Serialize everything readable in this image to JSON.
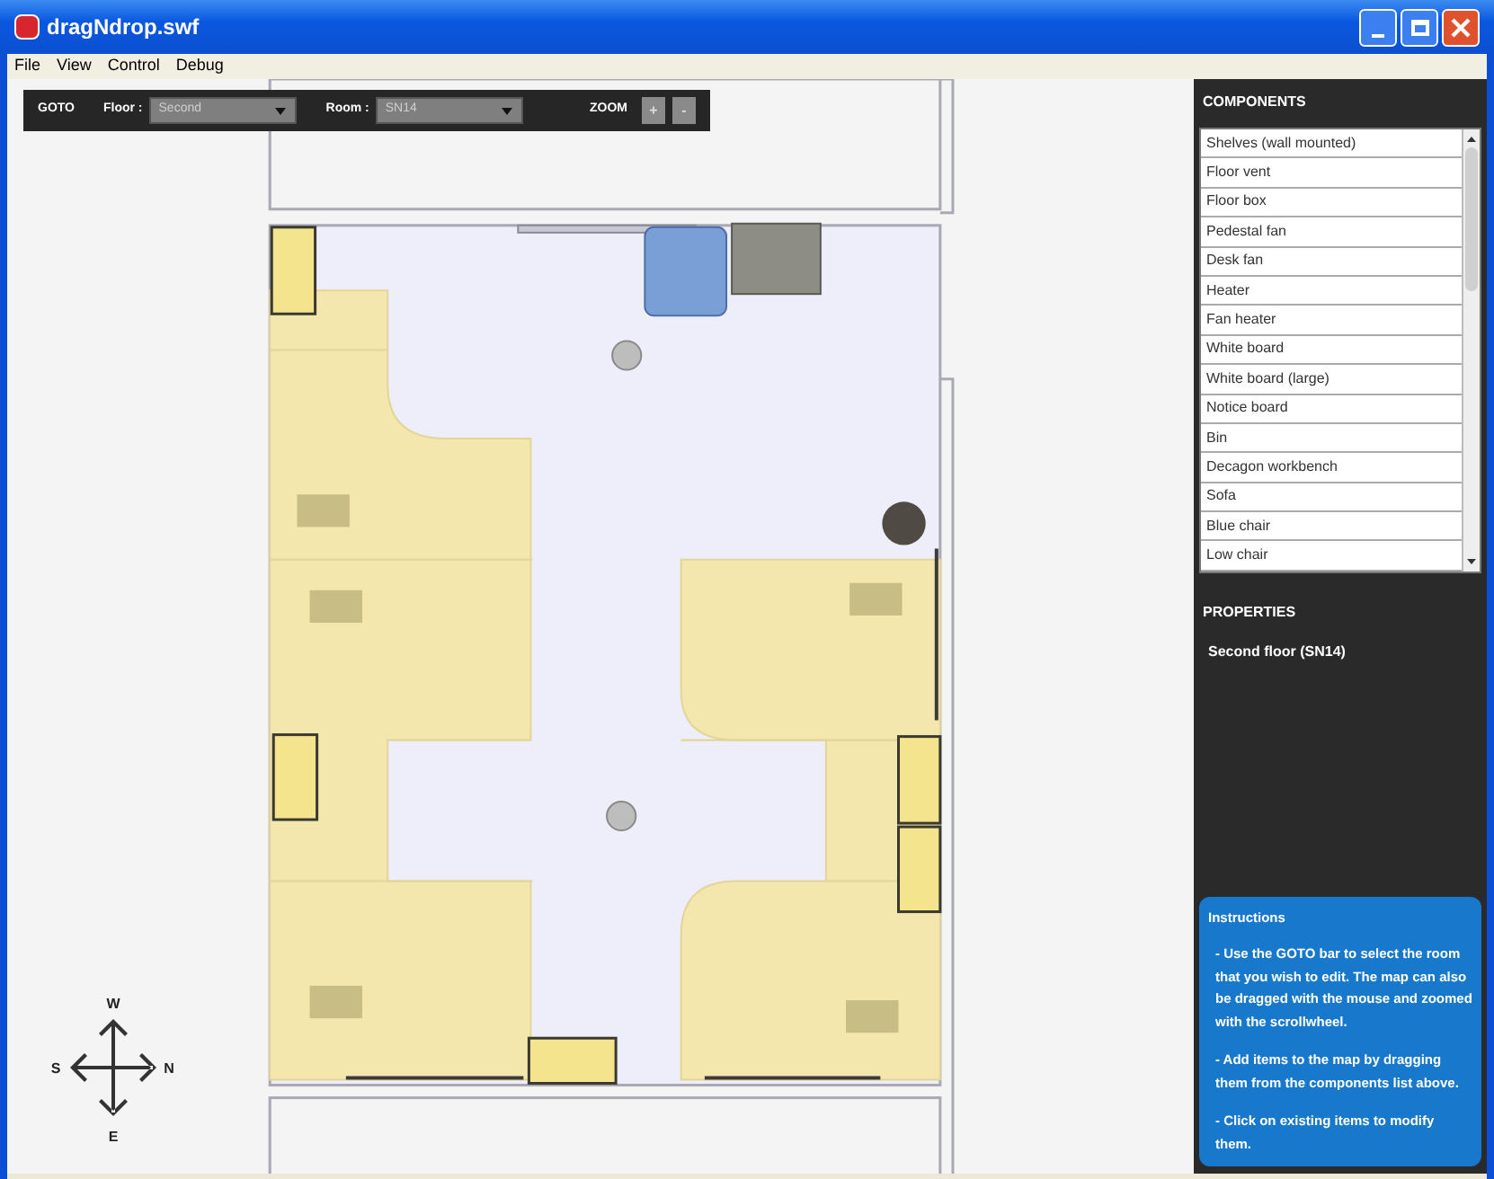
{
  "window": {
    "title": "dragNdrop.swf"
  },
  "menu": [
    "File",
    "View",
    "Control",
    "Debug"
  ],
  "toolbar": {
    "goto": "GOTO",
    "floor_label": "Floor :",
    "floor_value": "Second",
    "room_label": "Room :",
    "room_value": "SN14",
    "zoom_label": "ZOOM",
    "zoom_buttons": [
      "+",
      "-"
    ]
  },
  "compass": {
    "north": "N",
    "south": "S",
    "east": "E",
    "west": "W"
  },
  "components": {
    "title": "COMPONENTS",
    "items": [
      "Shelves (wall mounted)",
      "Floor vent",
      "Floor box",
      "Pedestal fan",
      "Desk fan",
      "Heater",
      "Fan heater",
      "White board",
      "White board (large)",
      "Notice board",
      "Bin",
      "Decagon workbench",
      "Sofa",
      "Blue chair",
      "Low chair"
    ]
  },
  "properties": {
    "title": "PROPERTIES",
    "text": "Second floor (SN14)"
  },
  "instructions": {
    "title": "Instructions",
    "paragraphs": [
      "- Use the GOTO bar to select the room that you wish to edit. The map can also be dragged with the mouse and zoomed with the scrollwheel.",
      "- Add items to the map by dragging them from the components list above.",
      "- Click on existing items to modify them."
    ]
  }
}
